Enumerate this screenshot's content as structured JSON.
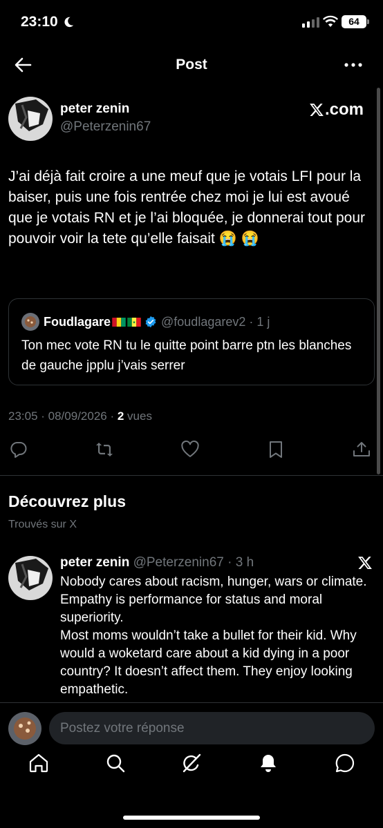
{
  "status_bar": {
    "time": "23:10",
    "battery": "64"
  },
  "header": {
    "title": "Post",
    "back_icon": "back-arrow-icon",
    "more_icon": "more-horizontal-icon"
  },
  "post": {
    "author_name": "peter zenin",
    "author_handle": "@Peterzenin67",
    "source_label": ".com",
    "text": "J’ai déjà fait croire a une meuf que je votais LFI pour la baiser, puis une fois rentrée chez moi je lui est avoué que je votais RN et je l’ai bloquée, je donnerai tout pour pouvoir voir la tete qu’elle faisait 😭 😭",
    "quote": {
      "name": "Foudlagare",
      "handle_time": "@foudlagarev2 · 1 j",
      "text": "Ton mec vote RN tu le quitte point barre ptn les blanches de gauche jpplu j’vais serrer"
    },
    "meta_time": "23:05 · 08/09/2026 · ",
    "views_count": "2",
    "views_label": " vues"
  },
  "actions": [
    "reply-icon",
    "repost-icon",
    "like-icon",
    "bookmark-icon",
    "share-icon"
  ],
  "discover": {
    "title": "Découvrez plus",
    "subtitle": "Trouvés sur X",
    "item": {
      "name": "peter zenin",
      "meta": " @Peterzenin67 · 3 h",
      "text": "Nobody cares about racism, hunger, wars or climate. Empathy is performance for status and moral superiority.\nMost moms wouldn’t take a bullet for their kid. Why would a woketard care about a kid dying in a poor country? It doesn’t affect them. They enjoy looking empathetic."
    }
  },
  "reply": {
    "placeholder": "Postez votre réponse"
  },
  "nav": [
    "home-icon",
    "search-icon",
    "grok-icon",
    "notifications-icon",
    "messages-icon"
  ],
  "colors": {
    "background": "#000000",
    "text": "#e7e9ea",
    "secondary": "#71767b",
    "verified": "#1d9bf0",
    "border": "#2f3336"
  }
}
